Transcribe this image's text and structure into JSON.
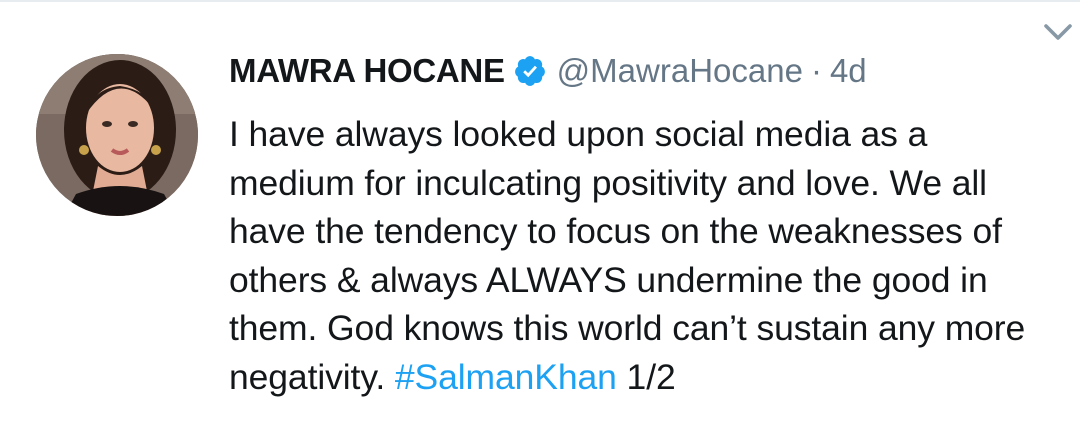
{
  "tweet": {
    "author_name": "MAWRA HOCANE",
    "handle": "@MawraHocane",
    "separator": "·",
    "time": "4d",
    "text_main": "I have always looked upon social media as a medium for inculcating positivity and love. We all have the tendency to focus on the weaknesses of others & always ALWAYS undermine the good in them. God knows this world can’t sustain any more negativity. ",
    "hashtag": "#SalmanKhan",
    "text_suffix": " 1/2",
    "icons": {
      "verified": "verified-badge-icon",
      "menu": "chevron-down-icon"
    },
    "colors": {
      "verified": "#1da1f2",
      "hashtag": "#1da1f2",
      "secondary_text": "#657786",
      "primary_text": "#14171a"
    }
  }
}
